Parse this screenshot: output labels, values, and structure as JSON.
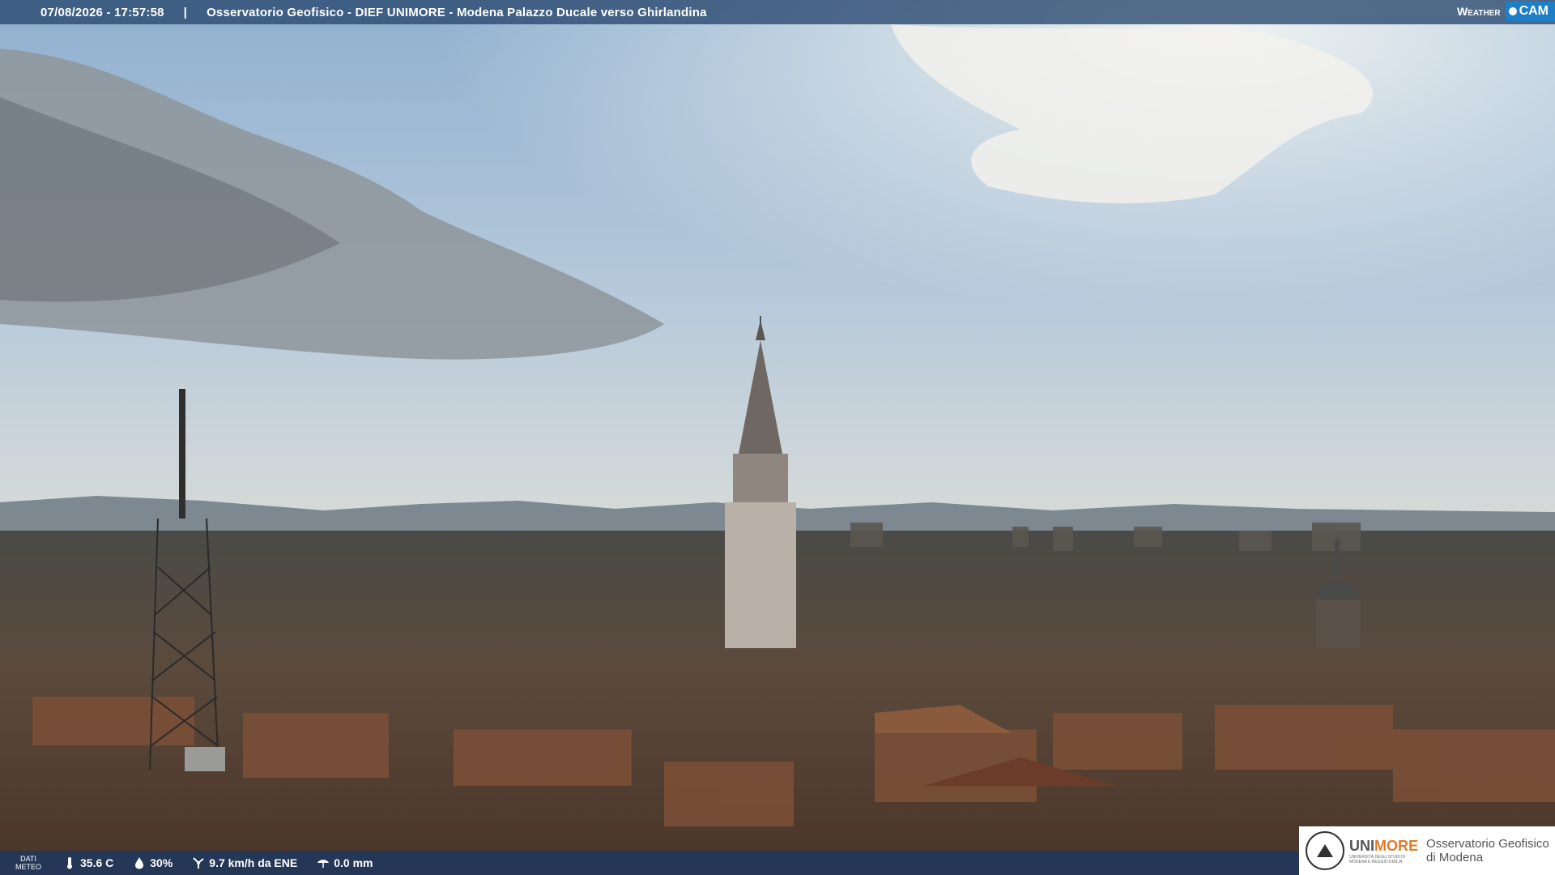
{
  "header": {
    "datetime": "07/08/2026 - 17:57:58",
    "separator": "|",
    "title": "Osservatorio Geofisico - DIEF UNIMORE - Modena Palazzo Ducale verso Ghirlandina"
  },
  "brand": {
    "weather": "Weather",
    "cam": "CAM"
  },
  "weather_data": {
    "label_line1": "DATI",
    "label_line2": "METEO",
    "temperature": "35.6 C",
    "humidity": "30%",
    "wind": "9.7 km/h da ENE",
    "rain": "0.0 mm",
    "icons": [
      "thermometer-icon",
      "humidity-drop-icon",
      "wind-icon",
      "rain-icon"
    ]
  },
  "logo": {
    "uni_part1": "UNI",
    "uni_part2": "MORE",
    "uni_sub1": "UNIVERSITÀ DEGLI STUDI DI",
    "uni_sub2": "MODENA E REGGIO EMILIA",
    "obs_line1": "Osservatorio Geofisico",
    "obs_line2": "di Modena"
  },
  "colors": {
    "accent": "#1f7fc6",
    "bar": "#28466e",
    "unimore_orange": "#e07a2a"
  }
}
